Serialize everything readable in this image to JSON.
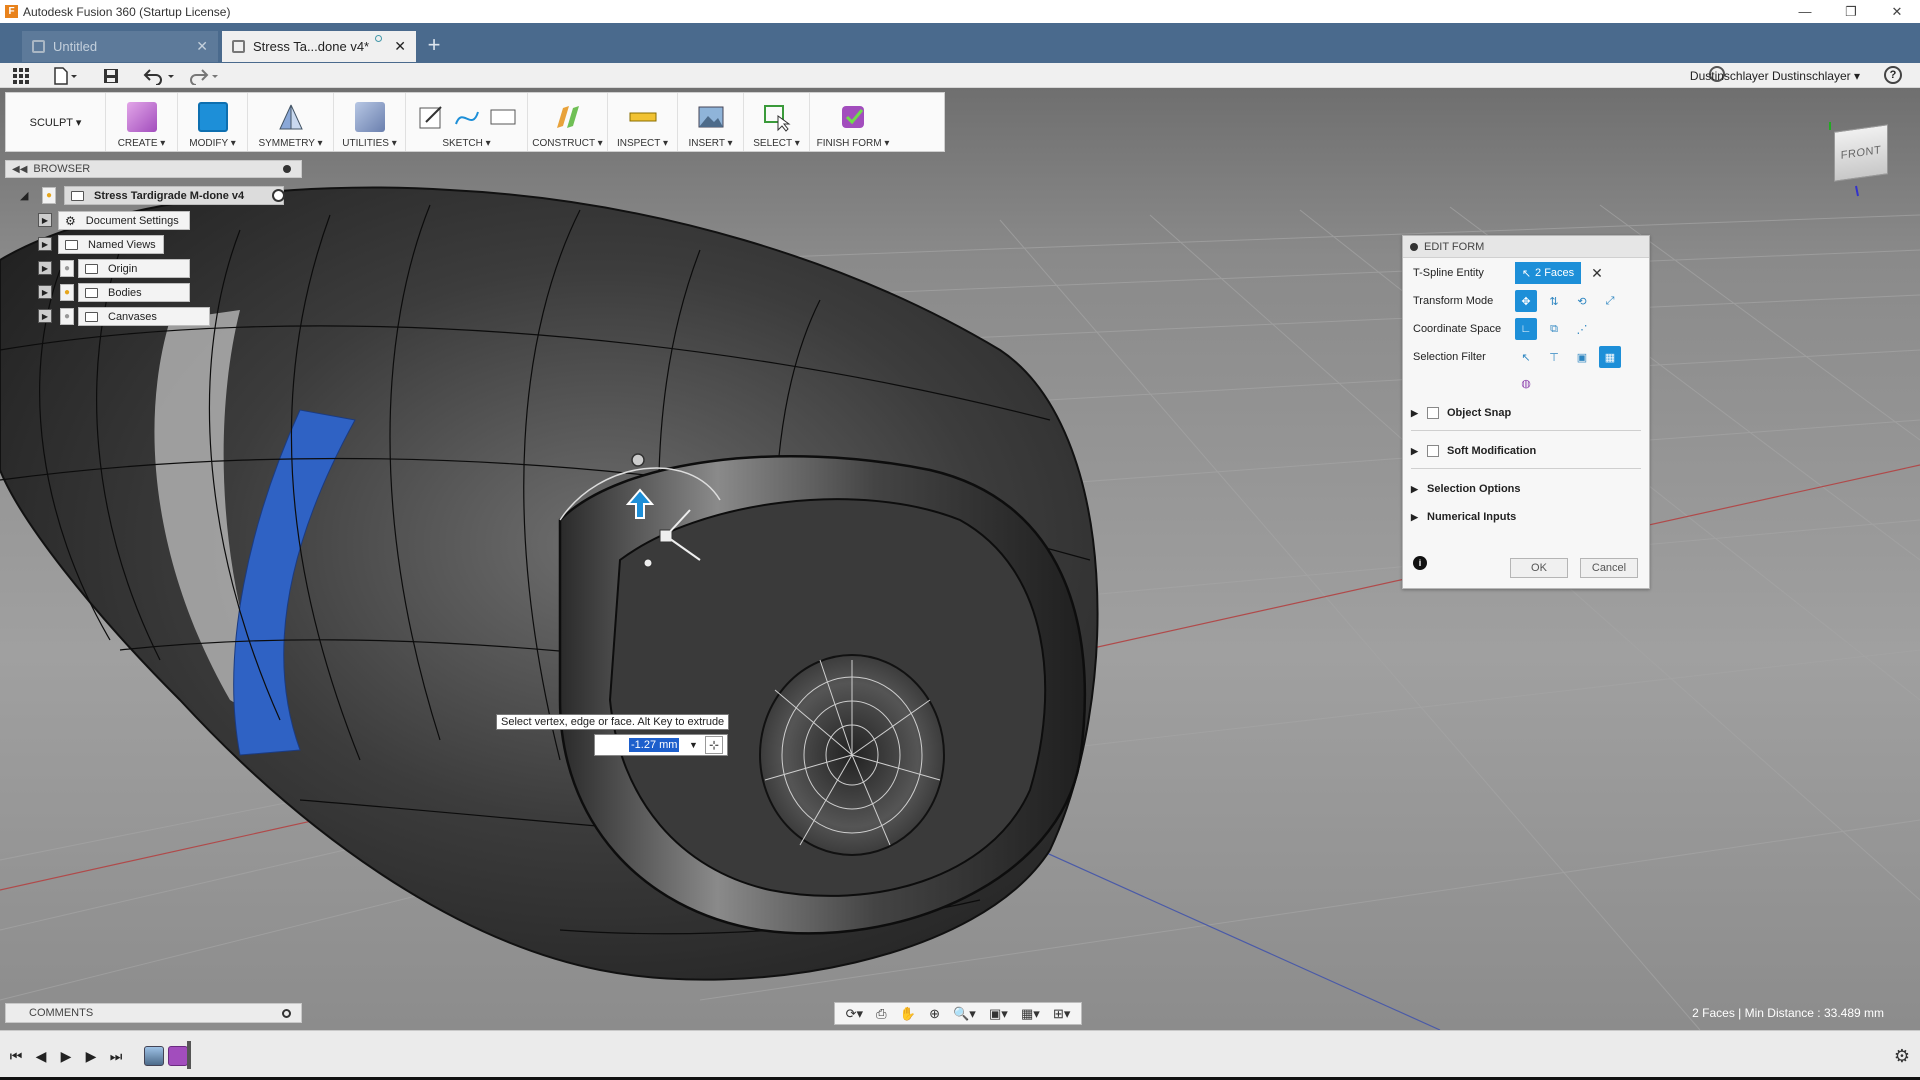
{
  "window": {
    "title": "Autodesk Fusion 360 (Startup License)",
    "app_icon": "F",
    "minimize": "—",
    "restore": "❐",
    "close": "✕"
  },
  "tabs": [
    {
      "label": "Untitled",
      "close": "✕"
    },
    {
      "label": "Stress Ta...done v4*",
      "close": "✕"
    }
  ],
  "new_tab": "+",
  "user": {
    "name": "Dustinschlayer Dustinschlayer ▾",
    "help": "?"
  },
  "toolbar": {
    "workspace": "SCULPT ▾",
    "groups": [
      {
        "label": "CREATE ▾"
      },
      {
        "label": "MODIFY ▾"
      },
      {
        "label": "SYMMETRY ▾"
      },
      {
        "label": "UTILITIES ▾"
      },
      {
        "label": "SKETCH ▾"
      },
      {
        "label": "CONSTRUCT ▾"
      },
      {
        "label": "INSPECT ▾"
      },
      {
        "label": "INSERT ▾"
      },
      {
        "label": "SELECT ▾"
      },
      {
        "label": "FINISH FORM ▾"
      }
    ]
  },
  "browser": {
    "title": "BROWSER",
    "root": "Stress Tardigrade M-done v4",
    "items": [
      {
        "label": "Document Settings"
      },
      {
        "label": "Named Views"
      },
      {
        "label": "Origin"
      },
      {
        "label": "Bodies"
      },
      {
        "label": "Canvases"
      }
    ]
  },
  "edit_form": {
    "title": "EDIT FORM",
    "entity_label": "T-Spline Entity",
    "entity_value": "2 Faces",
    "clear": "✕",
    "transform_mode_label": "Transform Mode",
    "coordinate_space_label": "Coordinate Space",
    "selection_filter_label": "Selection Filter",
    "object_snap": "Object Snap",
    "soft_modification": "Soft Modification",
    "selection_options": "Selection Options",
    "numerical_inputs": "Numerical Inputs",
    "ok": "OK",
    "cancel": "Cancel",
    "info": "i"
  },
  "tooltip": "Select vertex, edge or face. Alt Key to extrude",
  "distance_input": {
    "value": "-1.27 mm"
  },
  "viewcube": {
    "face": "FRONT"
  },
  "comments": {
    "title": "COMMENTS"
  },
  "status": "2 Faces | Min Distance : 33.489 mm",
  "colors": {
    "accent": "#1d8fd8",
    "tab_bar": "#4a6a8d",
    "selected_face": "#2f62c4"
  }
}
